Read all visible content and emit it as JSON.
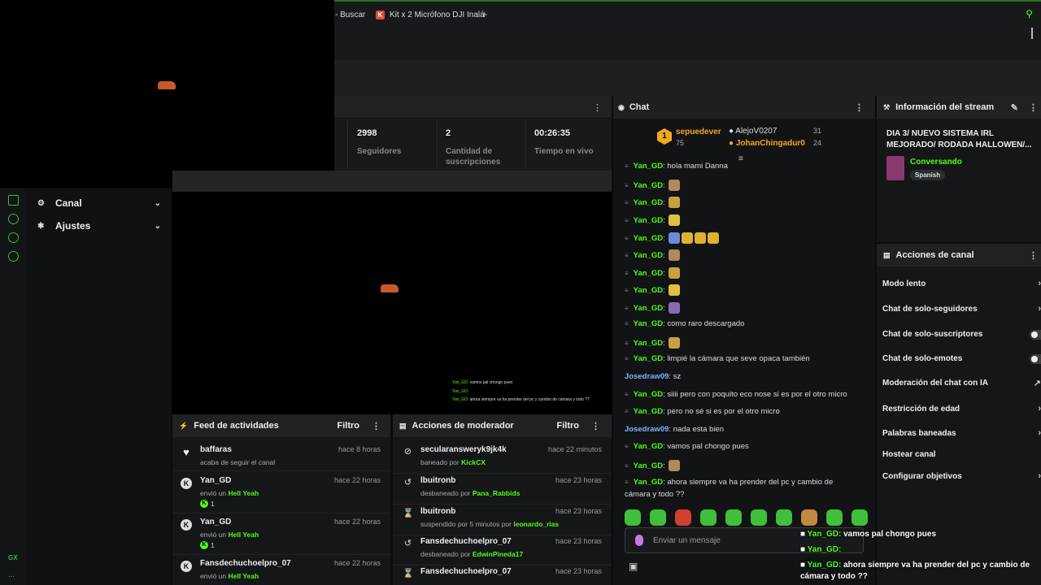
{
  "browser": {
    "tabs": [
      {
        "label": "- Buscar"
      },
      {
        "label": "Kit x 2 Micrófono DJI Inalá",
        "favicon": "K"
      }
    ],
    "new_tab": "+"
  },
  "sidebar": {
    "items": [
      {
        "label": "Canal",
        "icon": "channel-icon"
      },
      {
        "label": "Ajustes",
        "icon": "gear-icon"
      }
    ],
    "rail_label": "GX",
    "rail_more": "..."
  },
  "stats": [
    {
      "value": "2998",
      "label": "Seguidores"
    },
    {
      "value": "2",
      "label": "Cantidad de suscripciones"
    },
    {
      "value": "00:26:35",
      "label": "Tiempo en vivo"
    }
  ],
  "activity_feed": {
    "title": "Feed de actividades",
    "filter": "Filtro",
    "items": [
      {
        "name": "baffaras",
        "time": "hace 8 horas",
        "line": "acaba de seguir el canal",
        "highlight": "",
        "badge": ""
      },
      {
        "name": "Yan_GD",
        "time": "hace 22 horas",
        "line": "envió un",
        "highlight": "Hell Yeah",
        "badge": "1"
      },
      {
        "name": "Yan_GD",
        "time": "hace 22 horas",
        "line": "envió un",
        "highlight": "Hell Yeah",
        "badge": "1"
      },
      {
        "name": "Fansdechuchoelpro_07",
        "time": "hace 22 horas",
        "line": "envió un",
        "highlight": "Hell Yeah",
        "badge": ""
      }
    ]
  },
  "mod_actions": {
    "title": "Acciones de moderador",
    "filter": "Filtro",
    "items": [
      {
        "name": "secularansweryk9jk4k",
        "time": "hace 22 minutos",
        "line": "baneado por",
        "by": "KickCX",
        "icon": "ban-icon"
      },
      {
        "name": "lbuitronb",
        "time": "hace 23 horas",
        "line": "desbaneado por",
        "by": "Pana_Rabbids",
        "icon": "undo-icon"
      },
      {
        "name": "lbuitronb",
        "time": "hace 23 horas",
        "line": "suspendido por 5 minutos por",
        "by": "leonardo_rias",
        "icon": "hourglass-icon"
      },
      {
        "name": "Fansdechuchoelpro_07",
        "time": "hace 23 horas",
        "line": "desbaneado por",
        "by": "EdwinPineda17",
        "icon": "undo-icon"
      },
      {
        "name": "Fansdechuchoelpro_07",
        "time": "hace 23 horas",
        "line": "",
        "by": "",
        "icon": "hourglass-icon"
      }
    ]
  },
  "chat": {
    "title": "Chat",
    "leaderboard": [
      {
        "rank": "1",
        "name": "sepuedever",
        "count": "75"
      },
      {
        "name": "AlejoV0207",
        "count": "31"
      },
      {
        "name": "JohanChingadur0",
        "count": "24"
      }
    ],
    "messages": [
      {
        "user": "Yan_GD",
        "text": "hola mami Danna"
      },
      {
        "user": "Yan_GD",
        "text": "",
        "emotes": 1
      },
      {
        "user": "Yan_GD",
        "text": "",
        "emotes": 1
      },
      {
        "user": "Yan_GD",
        "text": "",
        "emotes": 1
      },
      {
        "user": "Yan_GD",
        "text": "",
        "emotes": 4
      },
      {
        "user": "Yan_GD",
        "text": "",
        "emotes": 1
      },
      {
        "user": "Yan_GD",
        "text": "",
        "emotes": 1
      },
      {
        "user": "Yan_GD",
        "text": "",
        "emotes": 1
      },
      {
        "user": "Yan_GD",
        "text": "",
        "emotes": 1
      },
      {
        "user": "Yan_GD",
        "text": "como raro descargado"
      },
      {
        "user": "Yan_GD",
        "text": "",
        "emotes": 1
      },
      {
        "user": "Yan_GD",
        "text": "limpié la cámara que seve opaca también"
      },
      {
        "user": "Josedraw09",
        "text": "sz",
        "alt": true
      },
      {
        "user": "Yan_GD",
        "text": "siiii pero con poquito eco nose si es por el otro micro"
      },
      {
        "user": "Yan_GD",
        "text": "pero no sé si es por el otro micro"
      },
      {
        "user": "Josedraw09",
        "text": "nada esta bien",
        "alt": true
      },
      {
        "user": "Yan_GD",
        "text": "vamos pal chongo pues"
      },
      {
        "user": "Yan_GD",
        "text": "",
        "emotes": 1
      },
      {
        "user": "Yan_GD",
        "text": "ahora siempre va ha prender del pc y cambio de"
      },
      {
        "user": "",
        "text": "cámara y todo ??"
      }
    ],
    "input_placeholder": "Enviar un mensaje"
  },
  "stream_info": {
    "title": "Información del stream",
    "stream_title": "DIA 3/ NUEVO SISTEMA IRL MEJORADO/ RODADA HALLOWEN/...",
    "category": "Conversando",
    "language": "Spanish"
  },
  "channel_actions": {
    "title": "Acciones de canal",
    "items": [
      {
        "label": "Modo lento",
        "control": "chevron"
      },
      {
        "label": "Chat de solo-seguidores",
        "control": "chevron"
      },
      {
        "label": "Chat de solo-suscriptores",
        "control": "toggle"
      },
      {
        "label": "Chat de solo-emotes",
        "control": "toggle"
      },
      {
        "label": "Moderación del chat con IA",
        "control": "external"
      },
      {
        "label": "Restricción de edad",
        "control": "chevron"
      },
      {
        "label": "Palabras baneadas",
        "control": "chevron"
      },
      {
        "label": "Hostear canal",
        "control": "none"
      },
      {
        "label": "Configurar objetivos",
        "control": "chevron"
      }
    ]
  },
  "video_overlay": [
    {
      "user": "Yan_GD:",
      "text": "vamos pal chongo pues"
    },
    {
      "user": "Yan_GD:",
      "text": ""
    },
    {
      "user": "Yan_GD:",
      "text": "ahora siempre va ha prender del pc y cambio de cámara y todo ??"
    }
  ],
  "colors": {
    "accent": "#53fc18",
    "background": "#0a0b0c",
    "panel": "#141618"
  }
}
